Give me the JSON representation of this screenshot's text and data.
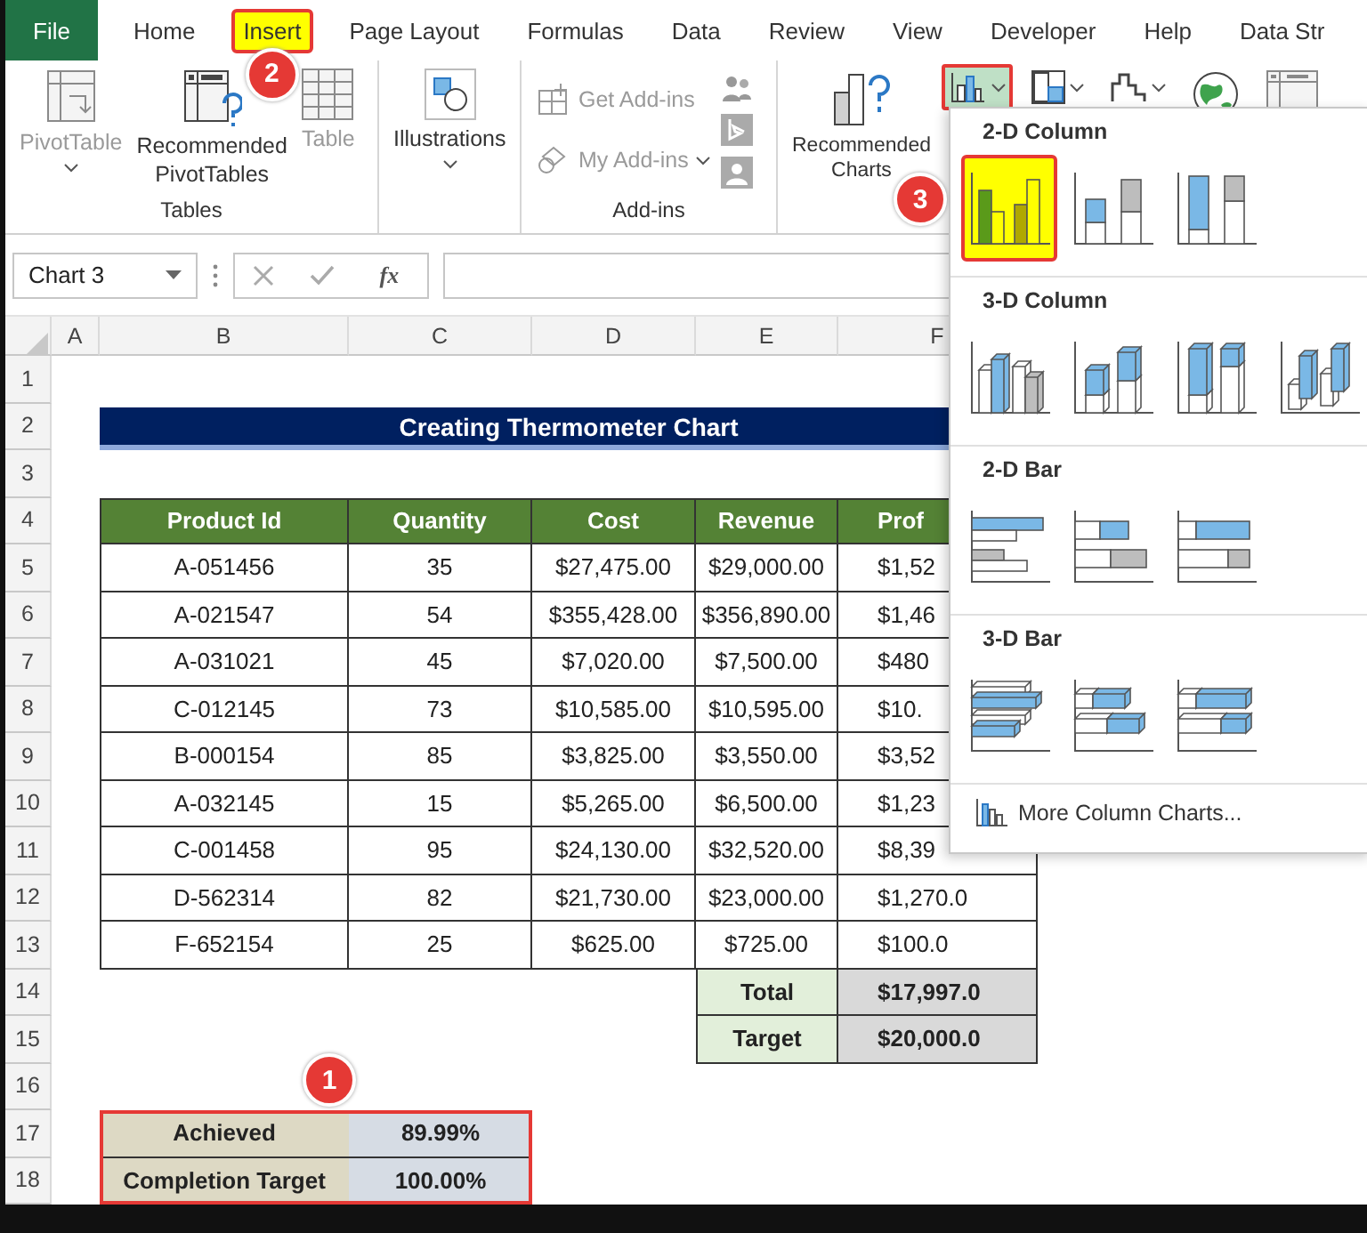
{
  "file_tab": "File",
  "tabs": [
    {
      "label": "Home",
      "selected": false
    },
    {
      "label": "Insert",
      "selected": true,
      "callout": "2"
    },
    {
      "label": "Page Layout",
      "selected": false
    },
    {
      "label": "Formulas",
      "selected": false
    },
    {
      "label": "Data",
      "selected": false
    },
    {
      "label": "Review",
      "selected": false
    },
    {
      "label": "View",
      "selected": false
    },
    {
      "label": "Developer",
      "selected": false
    },
    {
      "label": "Help",
      "selected": false
    },
    {
      "label": "Data Str",
      "selected": false
    }
  ],
  "tables_group": {
    "label": "Tables",
    "buttons": [
      {
        "kind": "pivot-table",
        "label": "PivotTable",
        "disabled": true,
        "dropdown": true
      },
      {
        "kind": "recommended-pivot",
        "label": "Recommended PivotTables",
        "disabled": false,
        "dropdown": false
      },
      {
        "kind": "table",
        "label": "Table",
        "disabled": true,
        "dropdown": false
      }
    ]
  },
  "illustrations_button": "Illustrations",
  "addins_group": {
    "label": "Add-ins",
    "buttons": [
      {
        "kind": "store",
        "label": "Get Add-ins",
        "disabled": true,
        "dropdown": false
      },
      {
        "kind": "addins",
        "label": "My Add-ins",
        "disabled": true,
        "dropdown": true
      }
    ]
  },
  "charts_group": {
    "recommended": "Recommended Charts",
    "buttons": [
      {
        "kind": "column",
        "selected": true
      },
      {
        "kind": "hierarchy",
        "selected": false
      },
      {
        "kind": "waterfall",
        "selected": false
      },
      {
        "kind": "map",
        "selected": false
      },
      {
        "kind": "pivot-chart",
        "selected": false
      }
    ]
  },
  "name_box": "Chart 3",
  "function_button": "fx",
  "column_headers": [
    "A",
    "B",
    "C",
    "D",
    "E",
    "F"
  ],
  "row_numbers": [
    "1",
    "2",
    "3",
    "4",
    "5",
    "6",
    "7",
    "8",
    "9",
    "10",
    "11",
    "12",
    "13",
    "14",
    "15",
    "16",
    "17",
    "18"
  ],
  "title": "Creating Thermometer Chart",
  "table": {
    "columns": [
      "Product Id",
      "Quantity",
      "Cost",
      "Revenue",
      "Prof"
    ],
    "rows": [
      [
        "A-051456",
        "35",
        "$27,475.00",
        "$29,000.00",
        "$1,52"
      ],
      [
        "A-021547",
        "54",
        "$355,428.00",
        "$356,890.00",
        "$1,46"
      ],
      [
        "A-031021",
        "45",
        "$7,020.00",
        "$7,500.00",
        "$480"
      ],
      [
        "C-012145",
        "73",
        "$10,585.00",
        "$10,595.00",
        "$10."
      ],
      [
        "B-000154",
        "85",
        "$3,825.00",
        "$3,550.00",
        "$3,52"
      ],
      [
        "A-032145",
        "15",
        "$5,265.00",
        "$6,500.00",
        "$1,23"
      ],
      [
        "C-001458",
        "95",
        "$24,130.00",
        "$32,520.00",
        "$8,39"
      ],
      [
        "D-562314",
        "82",
        "$21,730.00",
        "$23,000.00",
        "$1,270.0"
      ],
      [
        "F-652154",
        "25",
        "$625.00",
        "$725.00",
        "$100.0"
      ]
    ]
  },
  "summary": [
    {
      "label": "Total",
      "value": "$17,997.0"
    },
    {
      "label": "Target",
      "value": "$20,000.0"
    }
  ],
  "completion": {
    "callout": "1",
    "rows": [
      {
        "label": "Achieved",
        "value": "89.99%"
      },
      {
        "label": "Completion Target",
        "value": "100.00%"
      }
    ]
  },
  "chart_menu": {
    "sections": [
      {
        "title": "2-D Column",
        "items": [
          {
            "kind": "column-clustered",
            "selected": true,
            "callout": "3"
          },
          {
            "kind": "column-stacked",
            "selected": false
          },
          {
            "kind": "column-stacked100",
            "selected": false
          }
        ]
      },
      {
        "title": "3-D Column",
        "items": [
          {
            "kind": "column3d-clustered",
            "selected": false
          },
          {
            "kind": "column3d-stacked",
            "selected": false
          },
          {
            "kind": "column3d-stacked100",
            "selected": false
          },
          {
            "kind": "column3d",
            "selected": false
          }
        ]
      },
      {
        "title": "2-D Bar",
        "items": [
          {
            "kind": "bar-clustered",
            "selected": false
          },
          {
            "kind": "bar-stacked",
            "selected": false
          },
          {
            "kind": "bar-stacked100",
            "selected": false
          }
        ]
      },
      {
        "title": "3-D Bar",
        "items": [
          {
            "kind": "bar3d-clustered",
            "selected": false
          },
          {
            "kind": "bar3d-stacked",
            "selected": false
          },
          {
            "kind": "bar3d-stacked100",
            "selected": false
          }
        ]
      }
    ],
    "footer": "More Column Charts..."
  }
}
